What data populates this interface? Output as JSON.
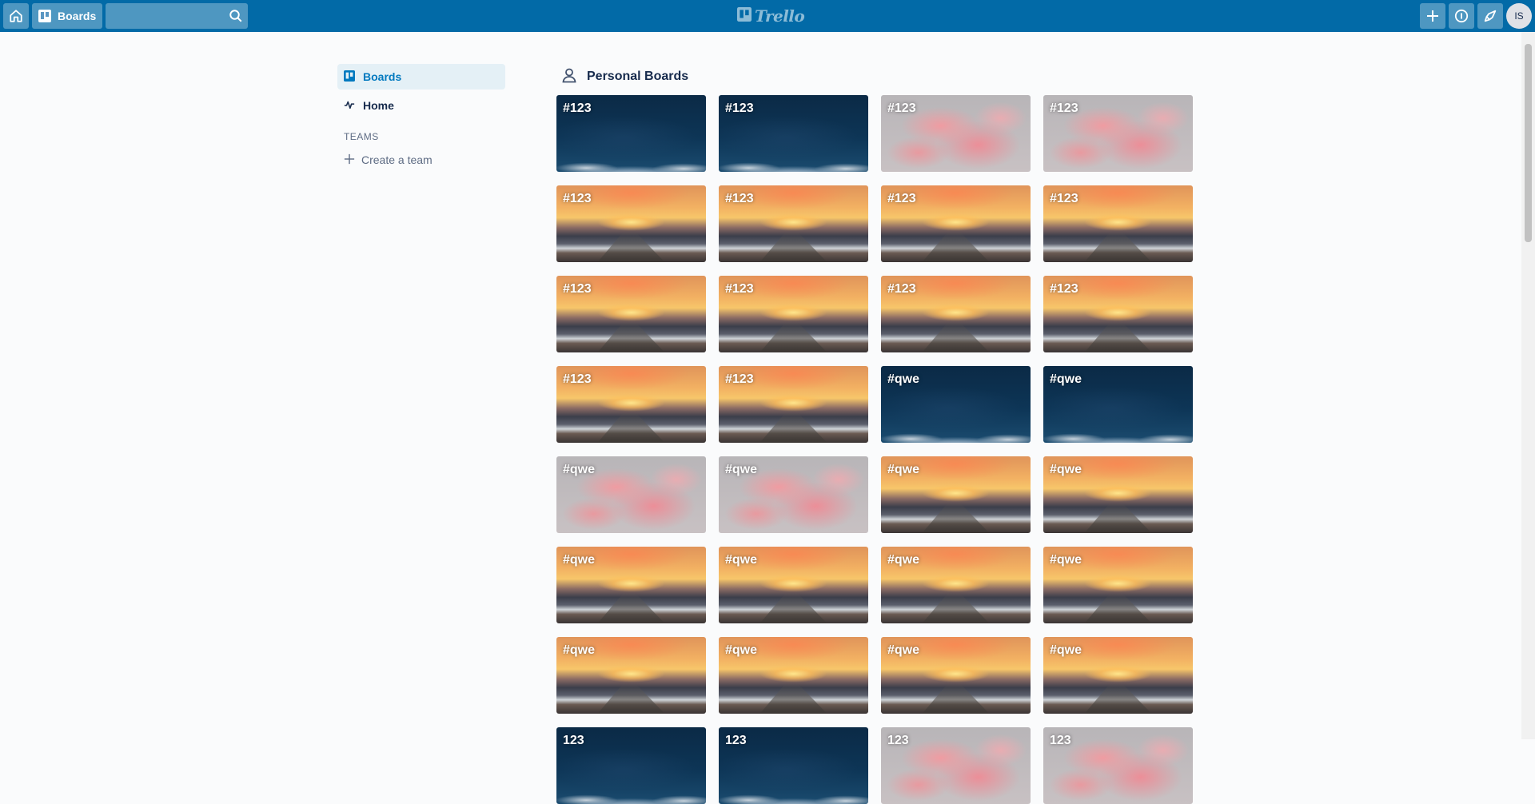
{
  "header": {
    "boards_label": "Boards",
    "search": {
      "value": "",
      "placeholder": ""
    },
    "logo_text": "Trello",
    "avatar_initials": "IS",
    "colors": {
      "bar": "#026aa7"
    }
  },
  "sidebar": {
    "items": [
      {
        "label": "Boards",
        "icon": "board-icon",
        "active": true
      },
      {
        "label": "Home",
        "icon": "activity-icon",
        "active": false
      }
    ],
    "teams_heading": "TEAMS",
    "create_team_label": "Create a team"
  },
  "main": {
    "section_title": "Personal Boards",
    "boards": [
      {
        "title": "#123",
        "bg": "night"
      },
      {
        "title": "#123",
        "bg": "night"
      },
      {
        "title": "#123",
        "bg": "smoke"
      },
      {
        "title": "#123",
        "bg": "smoke"
      },
      {
        "title": "#123",
        "bg": "sunset"
      },
      {
        "title": "#123",
        "bg": "sunset"
      },
      {
        "title": "#123",
        "bg": "sunset"
      },
      {
        "title": "#123",
        "bg": "sunset"
      },
      {
        "title": "#123",
        "bg": "sunset"
      },
      {
        "title": "#123",
        "bg": "sunset"
      },
      {
        "title": "#123",
        "bg": "sunset"
      },
      {
        "title": "#123",
        "bg": "sunset"
      },
      {
        "title": "#123",
        "bg": "sunset"
      },
      {
        "title": "#123",
        "bg": "sunset"
      },
      {
        "title": "#qwe",
        "bg": "night"
      },
      {
        "title": "#qwe",
        "bg": "night"
      },
      {
        "title": "#qwe",
        "bg": "smoke"
      },
      {
        "title": "#qwe",
        "bg": "smoke"
      },
      {
        "title": "#qwe",
        "bg": "sunset"
      },
      {
        "title": "#qwe",
        "bg": "sunset"
      },
      {
        "title": "#qwe",
        "bg": "sunset"
      },
      {
        "title": "#qwe",
        "bg": "sunset"
      },
      {
        "title": "#qwe",
        "bg": "sunset"
      },
      {
        "title": "#qwe",
        "bg": "sunset"
      },
      {
        "title": "#qwe",
        "bg": "sunset"
      },
      {
        "title": "#qwe",
        "bg": "sunset"
      },
      {
        "title": "#qwe",
        "bg": "sunset"
      },
      {
        "title": "#qwe",
        "bg": "sunset"
      },
      {
        "title": "123",
        "bg": "night"
      },
      {
        "title": "123",
        "bg": "night"
      },
      {
        "title": "123",
        "bg": "smoke"
      },
      {
        "title": "123",
        "bg": "smoke"
      }
    ]
  }
}
